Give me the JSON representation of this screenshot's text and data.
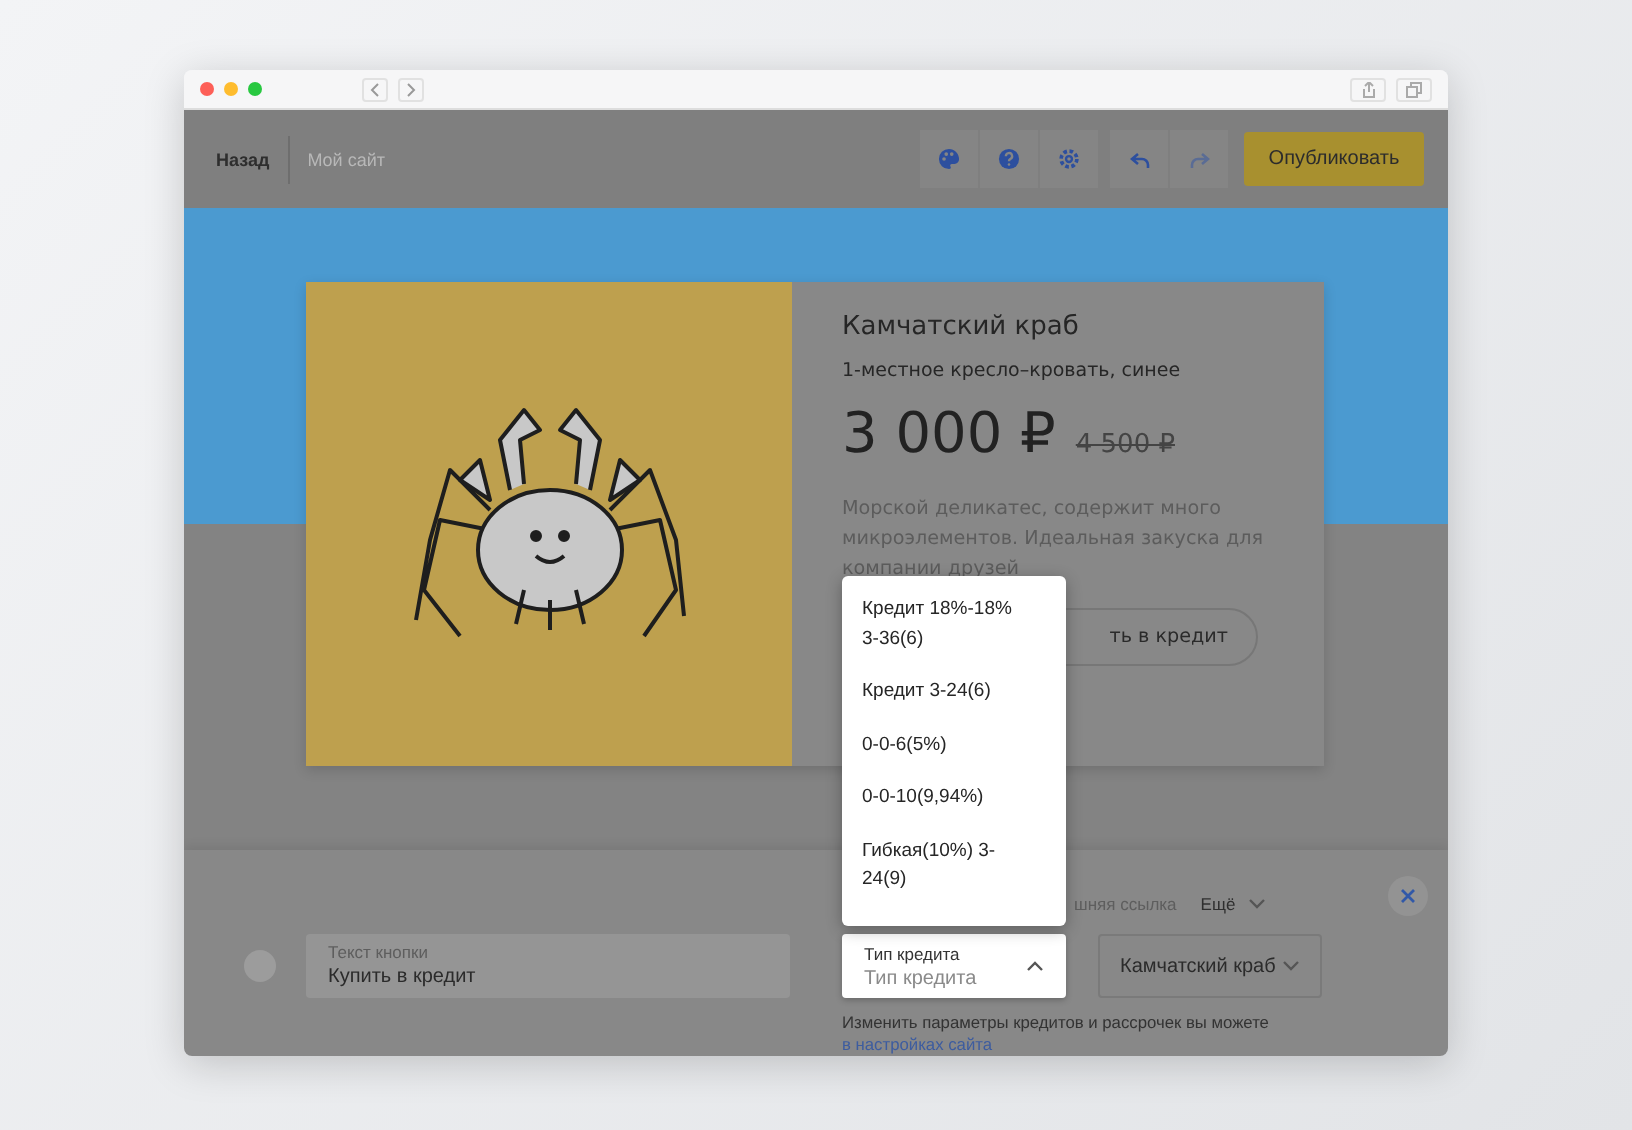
{
  "toolbar": {
    "back": "Назад",
    "site_name": "Мой сайт",
    "publish": "Опубликовать"
  },
  "product": {
    "title": "Камчатский краб",
    "subtitle": "1-местное кресло–кровать, синее",
    "price": "3 000 ₽",
    "old_price": "4 500 ₽",
    "description": "Морской деликатес, содержит много микроэлементов. Идеальная закуска для компании друзей",
    "button": "ть в кредит"
  },
  "credit_dropdown": {
    "options": [
      {
        "label": "Кредит 18%-18% 3-36(6)"
      },
      {
        "label": "Кредит 3-24(6)"
      },
      {
        "label": "0-0-6(5%)"
      },
      {
        "label": "0-0-10(9,94%)"
      },
      {
        "label": "Гибкая(10%) 3-24(9)"
      }
    ]
  },
  "editor": {
    "link_label": "шняя ссылка",
    "more": "Ещё",
    "button_text": {
      "label": "Текст кнопки",
      "value": "Купить в кредит"
    },
    "credit_type": {
      "label": "Тип кредита",
      "placeholder": "Тип кредита",
      "expanded": true
    },
    "product_select": "Камчатский краб",
    "note": "Изменить параметры кредитов и рассрочек вы можете",
    "note_link": "в настройках сайта"
  }
}
